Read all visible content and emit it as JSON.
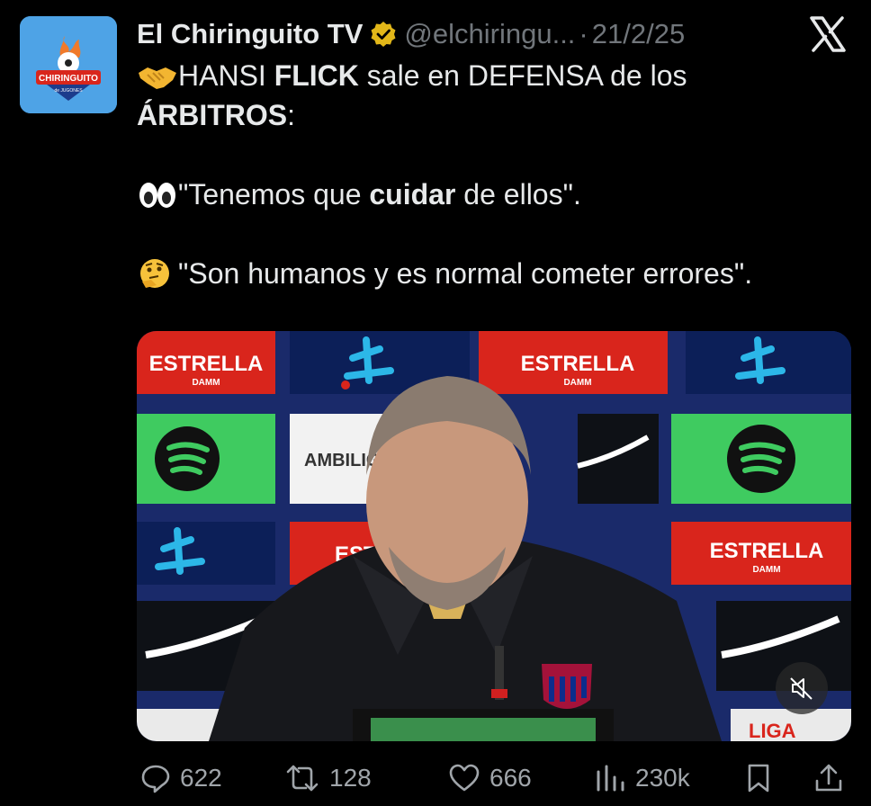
{
  "tweet": {
    "author_name": "El Chiringuito TV",
    "handle": "@elchiringu...",
    "separator": "·",
    "date": "21/2/25",
    "avatar_text": "CHIRINGUITO",
    "avatar_subtext": "de JUGONES",
    "lines": [
      {
        "pre": "HANSI ",
        "bold": "FLICK",
        "post": " sale en DEFENSA de los"
      },
      {
        "pre": "",
        "bold": "ÁRBITROS",
        "post": ":"
      },
      {
        "pre": "\"Tenemos que ",
        "bold": "cuidar",
        "post": " de ellos\"."
      },
      {
        "pre": "\"Son humanos y es normal cometer errores\".",
        "bold": "",
        "post": ""
      }
    ]
  },
  "media": {
    "sponsor_estrella": "ESTRELLA",
    "sponsor_damm": "DAMM",
    "sponsor_ambilight": "AMBILIGH",
    "sponsor_estr": "ESTR",
    "sponsor_liga": "LIGA"
  },
  "actions": {
    "replies": "622",
    "reposts": "128",
    "likes": "666",
    "views": "230k"
  },
  "colors": {
    "background": "#000000",
    "text": "#e7e9ea",
    "muted": "#71767b",
    "verified_gold": "#e2b719",
    "avatar_blue": "#4ea3e6"
  },
  "icons": [
    "verified-badge-icon",
    "x-logo-icon",
    "handshake-emoji-icon",
    "eyes-emoji-icon",
    "thinking-emoji-icon",
    "mute-icon",
    "reply-icon",
    "repost-icon",
    "like-icon",
    "views-icon",
    "bookmark-icon",
    "share-icon"
  ]
}
